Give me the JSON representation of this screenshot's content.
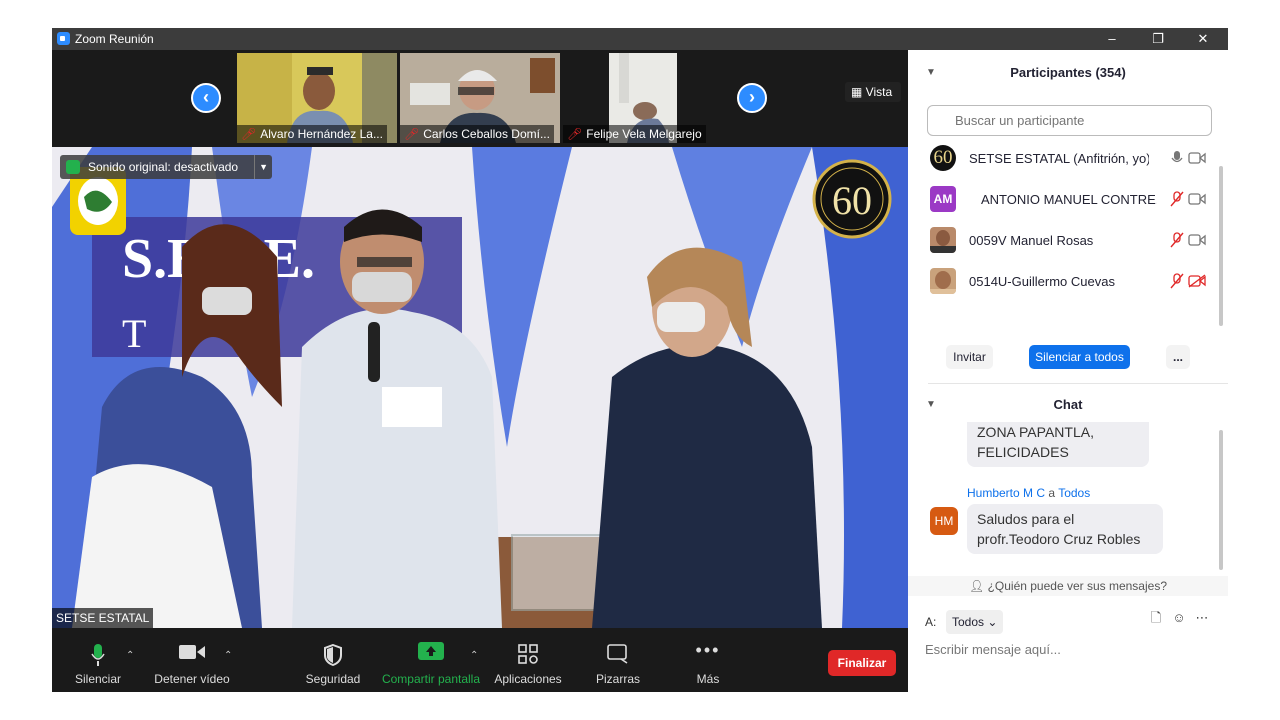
{
  "window": {
    "title": "Zoom Reunión",
    "minimize": "–",
    "maximize": "❐",
    "close": "✕"
  },
  "thumbnails": [
    {
      "name": "Alvaro Hernández La..."
    },
    {
      "name": "Carlos Ceballos Domí..."
    },
    {
      "name": "Felipe Vela Melgarejo"
    }
  ],
  "nav": {
    "prev": "‹",
    "next": "›"
  },
  "view_label": "Vista",
  "main_video": {
    "sound_badge": "Sonido original: desactivado",
    "speaker_name": "SETSE ESTATAL",
    "anniversary_number": "60"
  },
  "toolbar": {
    "mute": "Silenciar",
    "stop_video": "Detener vídeo",
    "security": "Seguridad",
    "share_screen": "Compartir pantalla",
    "apps": "Aplicaciones",
    "whiteboards": "Pizarras",
    "more": "Más",
    "end": "Finalizar"
  },
  "participants": {
    "header": "Participantes (354)",
    "search_placeholder": "Buscar un participante",
    "list": [
      {
        "name": "SETSE ESTATAL (Anfitrión, yo)",
        "avatar": "60",
        "muted": false,
        "video_off": false
      },
      {
        "name": "ANTONIO MANUEL CONTRE...",
        "avatar": "AM",
        "muted": true,
        "video_off": false
      },
      {
        "name": "0059V Manuel Rosas",
        "avatar": "",
        "muted": true,
        "video_off": false
      },
      {
        "name": "0514U-Guillermo Cuevas",
        "avatar": "",
        "muted": true,
        "video_off": true
      }
    ],
    "invite": "Invitar",
    "mute_all": "Silenciar a todos",
    "more": "..."
  },
  "chat": {
    "header": "Chat",
    "prev_message": "ZONA PAPANTLA,\nFELICIDADES",
    "sender": "Humberto M C",
    "to_word": "a",
    "recipient": "Todos",
    "sender_initials": "HM",
    "message": "Saludos para el\nprofr.Teodoro Cruz Robles",
    "who_sees": "¿Quién puede ver sus mensajes?",
    "to_label": "A:",
    "to_value": "Todos",
    "input_placeholder": "Escribir mensaje aquí..."
  },
  "colors": {
    "accent": "#0e71eb",
    "share_green": "#23b14d",
    "end_red": "#e02828",
    "muted_red": "#e02828"
  }
}
